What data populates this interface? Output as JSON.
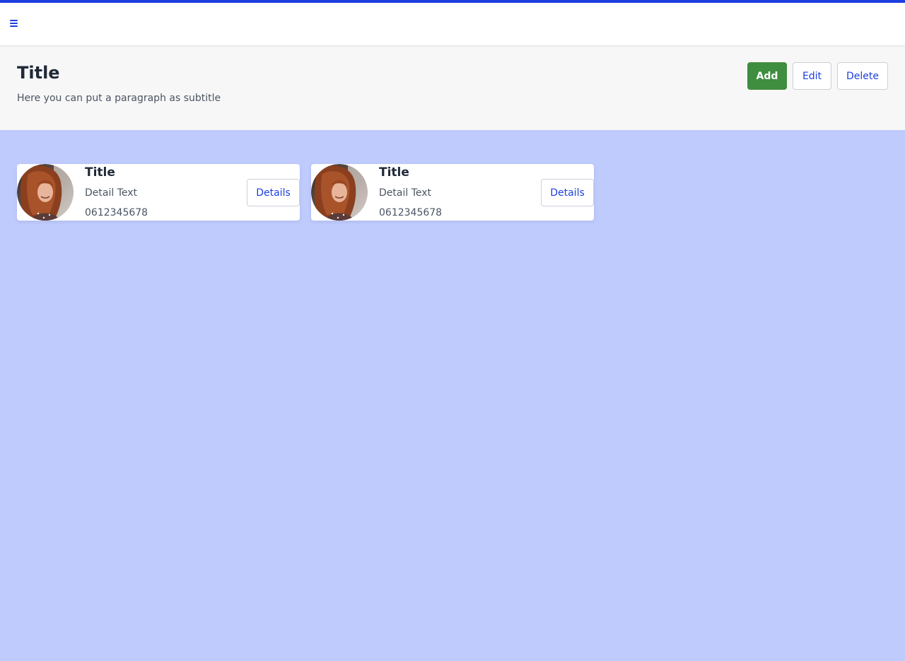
{
  "topbar": {
    "menu_icon": "hamburger-menu-icon",
    "accent_color": "#1d3fe0"
  },
  "header": {
    "title": "Title",
    "subtitle": "Here you can put a paragraph as subtitle",
    "actions": {
      "add_label": "Add",
      "edit_label": "Edit",
      "delete_label": "Delete"
    }
  },
  "colors": {
    "page_background": "#bfcbfd",
    "primary_button": "#3f8d3f",
    "link_blue": "#1d3fe0"
  },
  "cards": [
    {
      "title": "Title",
      "detail": "Detail Text",
      "phone": "0612345678",
      "button_label": "Details"
    },
    {
      "title": "Title",
      "detail": "Detail Text",
      "phone": "0612345678",
      "button_label": "Details"
    }
  ]
}
